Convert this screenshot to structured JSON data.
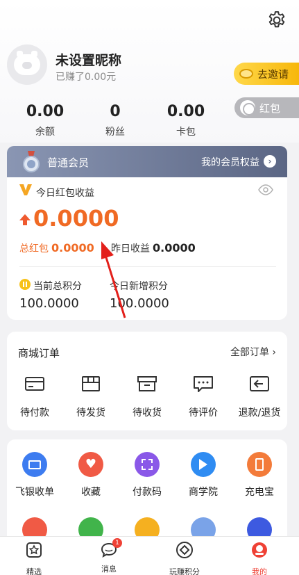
{
  "profile": {
    "nickname": "未设置昵称",
    "earned": "已赚了0.00元",
    "invite_label": "去邀请",
    "redpack_label": "红包"
  },
  "stats": [
    {
      "value": "0.00",
      "label": "余额"
    },
    {
      "value": "0",
      "label": "粉丝"
    },
    {
      "value": "0.00",
      "label": "卡包"
    }
  ],
  "member": {
    "title": "普通会员",
    "link": "我的会员权益",
    "arrow": "›"
  },
  "income": {
    "today_label": "今日红包收益",
    "today_value": "0.0000",
    "total_red_label": "总红包",
    "total_red_value": "0.0000",
    "yesterday_label": "昨日收益",
    "yesterday_value": "0.0000",
    "points_label": "当前总积分",
    "points_value": "100.0000",
    "new_points_label": "今日新增积分",
    "new_points_value": "100.0000"
  },
  "orders": {
    "title": "商城订单",
    "all_label": "全部订单",
    "items": [
      {
        "label": "待付款",
        "icon": "card-icon"
      },
      {
        "label": "待发货",
        "icon": "package-icon"
      },
      {
        "label": "待收货",
        "icon": "box-icon"
      },
      {
        "label": "待评价",
        "icon": "comment-icon"
      },
      {
        "label": "退款/退货",
        "icon": "return-icon"
      }
    ]
  },
  "tools": {
    "items": [
      {
        "label": "飞银收单",
        "icon": "bankcard-icon",
        "color": "#3d7cf0"
      },
      {
        "label": "收藏",
        "icon": "heart-icon",
        "color": "#f05a45"
      },
      {
        "label": "付款码",
        "icon": "qrcode-icon",
        "color": "#8a58e8"
      },
      {
        "label": "商学院",
        "icon": "video-icon",
        "color": "#2f8cf2"
      },
      {
        "label": "充电宝",
        "icon": "powerbank-icon",
        "color": "#f37b3a"
      }
    ],
    "row2_colors": [
      "#f05a45",
      "#41b44b",
      "#f5b020",
      "#7aa3e8",
      "#3d5ae0"
    ]
  },
  "tabbar": {
    "items": [
      {
        "label": "精选",
        "icon": "star-box-icon"
      },
      {
        "label": "消息",
        "icon": "chat-icon",
        "badge": "1"
      },
      {
        "label": "玩赚积分",
        "icon": "diamond-circle-icon"
      },
      {
        "label": "我的",
        "icon": "profile-icon",
        "active": true
      }
    ]
  }
}
